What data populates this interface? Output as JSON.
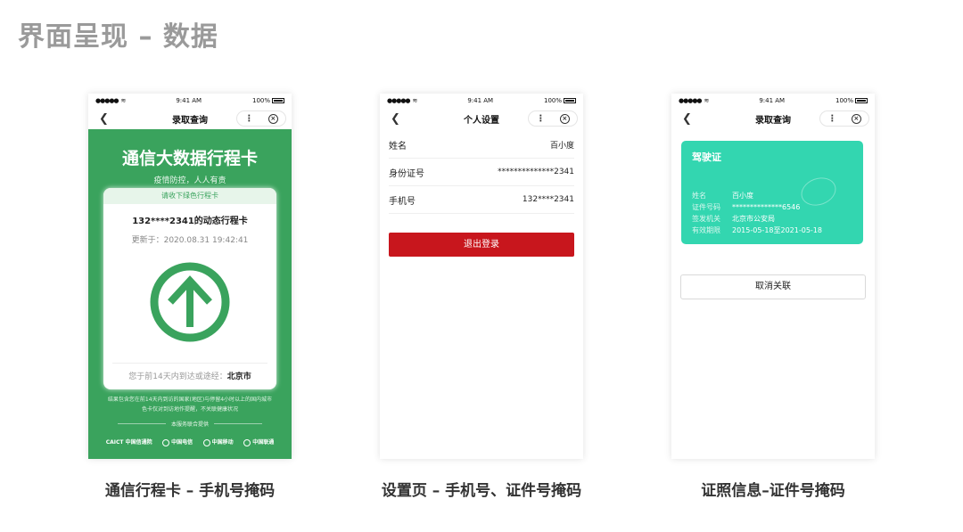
{
  "page_title": "界面呈现 – 数据",
  "status": {
    "signal": "●●●●●",
    "time": "9:41 AM",
    "battery": "100%"
  },
  "phone1": {
    "nav_title": "录取查询",
    "more": "⋮",
    "close": "×",
    "heading": "通信大数据行程卡",
    "slogan": "疫情防控，人人有责",
    "banner": "请收下绿色行程卡",
    "masked_phone": "132****2341的动态行程卡",
    "updated": "更新于：2020.08.31 19:42:41",
    "location_prefix": "您于前14天内到达或途经：",
    "location": "北京市",
    "disclaimer": "结果包含您在前14天内到访的国家(地区)与停留4小时以上的国内城市 色卡仅对到访地作提醒，不关联健康状况",
    "provider": "本服务联合提供",
    "logos": [
      "CAICT 中国信通院",
      "中国电信",
      "中国移动",
      "中国联通"
    ],
    "color_green": "#3aa35d"
  },
  "caption1": "通信行程卡 – 手机号掩码",
  "phone2": {
    "nav_title": "个人设置",
    "rows": [
      {
        "label": "姓名",
        "value": "百小度"
      },
      {
        "label": "身份证号",
        "value": "**************2341"
      },
      {
        "label": "手机号",
        "value": "132****2341"
      }
    ],
    "logout": "退出登录",
    "color_red": "#c8161d"
  },
  "caption2": "设置页 – 手机号、证件号掩码",
  "phone3": {
    "nav_title": "录取查询",
    "card_title": "驾驶证",
    "rows": [
      {
        "label": "姓名",
        "value": "百小度"
      },
      {
        "label": "证件号码",
        "value": "**************6546"
      },
      {
        "label": "签发机关",
        "value": "北京市公安局"
      },
      {
        "label": "有效期限",
        "value": "2015-05-18至2021-05-18"
      }
    ],
    "unlink": "取消关联",
    "color_teal": "#33d6b0"
  },
  "caption3": "证照信息–证件号掩码"
}
